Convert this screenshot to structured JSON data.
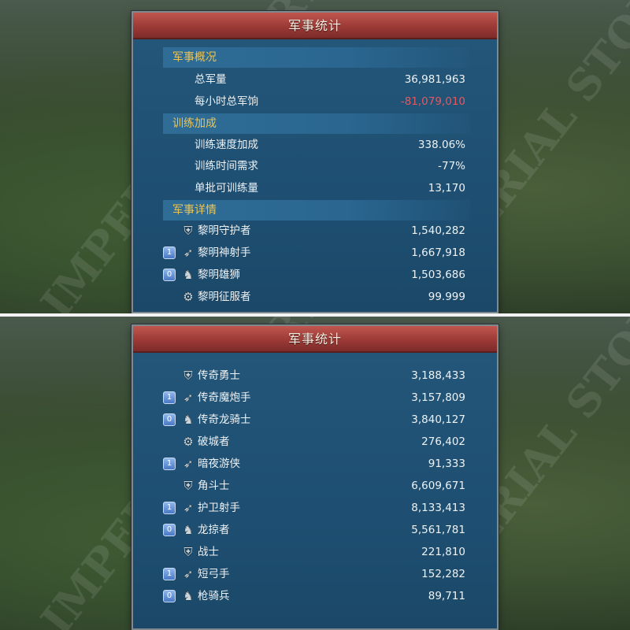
{
  "top": {
    "title": "军事统计",
    "overview": {
      "heading": "军事概况",
      "rows": [
        {
          "label": "总军量",
          "value": "36,981,963"
        },
        {
          "label": "每小时总军饷",
          "value": "-81,079,010"
        }
      ]
    },
    "training": {
      "heading": "训练加成",
      "rows": [
        {
          "label": "训练速度加成",
          "value": "338.06%"
        },
        {
          "label": "训练时间需求",
          "value": "-77%"
        },
        {
          "label": "单批可训练量",
          "value": "13,170"
        }
      ]
    },
    "details": {
      "heading": "军事详情",
      "units": [
        {
          "badge": "",
          "icon": "shield-sword-icon",
          "label": "黎明守护者",
          "value": "1,540,282"
        },
        {
          "badge": "1",
          "icon": "bow-icon",
          "label": "黎明神射手",
          "value": "1,667,918"
        },
        {
          "badge": "0",
          "icon": "horse-icon",
          "label": "黎明雄狮",
          "value": "1,503,686"
        },
        {
          "badge": "",
          "icon": "siege-icon",
          "label": "黎明征服者",
          "value": "99.999"
        }
      ]
    }
  },
  "bottom": {
    "title": "军事统计",
    "units": [
      {
        "badge": "",
        "icon": "shield-sword-icon",
        "label": "传奇勇士",
        "value": "3,188,433"
      },
      {
        "badge": "1",
        "icon": "bow-icon",
        "label": "传奇魔炮手",
        "value": "3,157,809"
      },
      {
        "badge": "0",
        "icon": "horse-icon",
        "label": "传奇龙骑士",
        "value": "3,840,127"
      },
      {
        "badge": "",
        "icon": "siege-icon",
        "label": "破城者",
        "value": "276,402"
      },
      {
        "badge": "1",
        "icon": "bow-icon",
        "label": "暗夜游侠",
        "value": "91,333"
      },
      {
        "badge": "",
        "icon": "shield-sword-icon",
        "label": "角斗士",
        "value": "6,609,671"
      },
      {
        "badge": "1",
        "icon": "bow-icon",
        "label": "护卫射手",
        "value": "8,133,413"
      },
      {
        "badge": "0",
        "icon": "horse-icon",
        "label": "龙掠者",
        "value": "5,561,781"
      },
      {
        "badge": "",
        "icon": "shield-sword-icon",
        "label": "战士",
        "value": "221,810"
      },
      {
        "badge": "1",
        "icon": "bow-icon",
        "label": "短弓手",
        "value": "152,282"
      },
      {
        "badge": "0",
        "icon": "horse-icon",
        "label": "枪骑兵",
        "value": "89,711"
      }
    ]
  },
  "colors": {
    "panel_bg": "#1e4f72",
    "title_bar": "#9c3a36",
    "section_text": "#e9c45a",
    "negative_value": "#e05a63"
  }
}
